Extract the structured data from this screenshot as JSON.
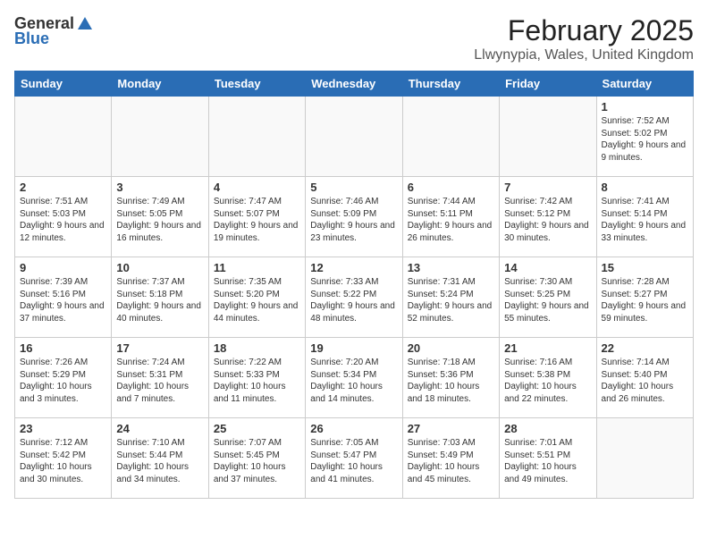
{
  "logo": {
    "general": "General",
    "blue": "Blue"
  },
  "title": "February 2025",
  "subtitle": "Llwynypia, Wales, United Kingdom",
  "headers": [
    "Sunday",
    "Monday",
    "Tuesday",
    "Wednesday",
    "Thursday",
    "Friday",
    "Saturday"
  ],
  "weeks": [
    [
      {
        "day": "",
        "info": ""
      },
      {
        "day": "",
        "info": ""
      },
      {
        "day": "",
        "info": ""
      },
      {
        "day": "",
        "info": ""
      },
      {
        "day": "",
        "info": ""
      },
      {
        "day": "",
        "info": ""
      },
      {
        "day": "1",
        "info": "Sunrise: 7:52 AM\nSunset: 5:02 PM\nDaylight: 9 hours and 9 minutes."
      }
    ],
    [
      {
        "day": "2",
        "info": "Sunrise: 7:51 AM\nSunset: 5:03 PM\nDaylight: 9 hours and 12 minutes."
      },
      {
        "day": "3",
        "info": "Sunrise: 7:49 AM\nSunset: 5:05 PM\nDaylight: 9 hours and 16 minutes."
      },
      {
        "day": "4",
        "info": "Sunrise: 7:47 AM\nSunset: 5:07 PM\nDaylight: 9 hours and 19 minutes."
      },
      {
        "day": "5",
        "info": "Sunrise: 7:46 AM\nSunset: 5:09 PM\nDaylight: 9 hours and 23 minutes."
      },
      {
        "day": "6",
        "info": "Sunrise: 7:44 AM\nSunset: 5:11 PM\nDaylight: 9 hours and 26 minutes."
      },
      {
        "day": "7",
        "info": "Sunrise: 7:42 AM\nSunset: 5:12 PM\nDaylight: 9 hours and 30 minutes."
      },
      {
        "day": "8",
        "info": "Sunrise: 7:41 AM\nSunset: 5:14 PM\nDaylight: 9 hours and 33 minutes."
      }
    ],
    [
      {
        "day": "9",
        "info": "Sunrise: 7:39 AM\nSunset: 5:16 PM\nDaylight: 9 hours and 37 minutes."
      },
      {
        "day": "10",
        "info": "Sunrise: 7:37 AM\nSunset: 5:18 PM\nDaylight: 9 hours and 40 minutes."
      },
      {
        "day": "11",
        "info": "Sunrise: 7:35 AM\nSunset: 5:20 PM\nDaylight: 9 hours and 44 minutes."
      },
      {
        "day": "12",
        "info": "Sunrise: 7:33 AM\nSunset: 5:22 PM\nDaylight: 9 hours and 48 minutes."
      },
      {
        "day": "13",
        "info": "Sunrise: 7:31 AM\nSunset: 5:24 PM\nDaylight: 9 hours and 52 minutes."
      },
      {
        "day": "14",
        "info": "Sunrise: 7:30 AM\nSunset: 5:25 PM\nDaylight: 9 hours and 55 minutes."
      },
      {
        "day": "15",
        "info": "Sunrise: 7:28 AM\nSunset: 5:27 PM\nDaylight: 9 hours and 59 minutes."
      }
    ],
    [
      {
        "day": "16",
        "info": "Sunrise: 7:26 AM\nSunset: 5:29 PM\nDaylight: 10 hours and 3 minutes."
      },
      {
        "day": "17",
        "info": "Sunrise: 7:24 AM\nSunset: 5:31 PM\nDaylight: 10 hours and 7 minutes."
      },
      {
        "day": "18",
        "info": "Sunrise: 7:22 AM\nSunset: 5:33 PM\nDaylight: 10 hours and 11 minutes."
      },
      {
        "day": "19",
        "info": "Sunrise: 7:20 AM\nSunset: 5:34 PM\nDaylight: 10 hours and 14 minutes."
      },
      {
        "day": "20",
        "info": "Sunrise: 7:18 AM\nSunset: 5:36 PM\nDaylight: 10 hours and 18 minutes."
      },
      {
        "day": "21",
        "info": "Sunrise: 7:16 AM\nSunset: 5:38 PM\nDaylight: 10 hours and 22 minutes."
      },
      {
        "day": "22",
        "info": "Sunrise: 7:14 AM\nSunset: 5:40 PM\nDaylight: 10 hours and 26 minutes."
      }
    ],
    [
      {
        "day": "23",
        "info": "Sunrise: 7:12 AM\nSunset: 5:42 PM\nDaylight: 10 hours and 30 minutes."
      },
      {
        "day": "24",
        "info": "Sunrise: 7:10 AM\nSunset: 5:44 PM\nDaylight: 10 hours and 34 minutes."
      },
      {
        "day": "25",
        "info": "Sunrise: 7:07 AM\nSunset: 5:45 PM\nDaylight: 10 hours and 37 minutes."
      },
      {
        "day": "26",
        "info": "Sunrise: 7:05 AM\nSunset: 5:47 PM\nDaylight: 10 hours and 41 minutes."
      },
      {
        "day": "27",
        "info": "Sunrise: 7:03 AM\nSunset: 5:49 PM\nDaylight: 10 hours and 45 minutes."
      },
      {
        "day": "28",
        "info": "Sunrise: 7:01 AM\nSunset: 5:51 PM\nDaylight: 10 hours and 49 minutes."
      },
      {
        "day": "",
        "info": ""
      }
    ]
  ]
}
